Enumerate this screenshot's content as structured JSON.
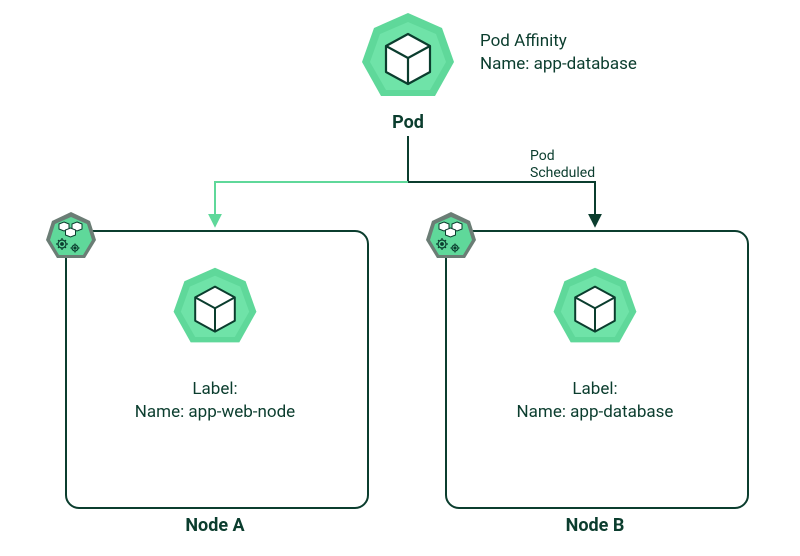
{
  "pod": {
    "label": "Pod",
    "affinity_line1": "Pod Affinity",
    "affinity_line2": "Name: app-database"
  },
  "scheduled_label_line1": "Pod",
  "scheduled_label_line2": "Scheduled",
  "nodes": {
    "a": {
      "title": "Node A",
      "label_line1": "Label:",
      "label_line2": "Name: app-web-node"
    },
    "b": {
      "title": "Node B",
      "label_line1": "Label:",
      "label_line2": "Name: app-database"
    }
  },
  "colors": {
    "green_light": "#5fd89a",
    "green_mid": "#34c77a",
    "green_dark": "#0b3d2e",
    "gray_badge": "#6b7d75"
  }
}
